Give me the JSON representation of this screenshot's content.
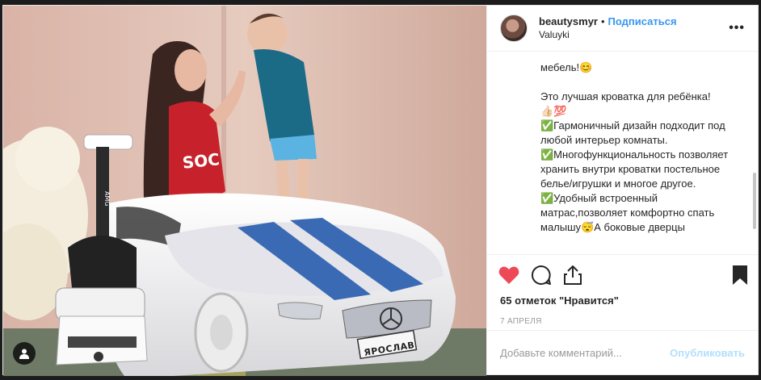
{
  "post": {
    "username": "beautysmyr",
    "separator": "•",
    "follow_label": "Подписаться",
    "location": "Valuyki",
    "more_label": "•••"
  },
  "photo": {
    "plate_text": "ЯРОСЛАВ"
  },
  "caption": {
    "lines": [
      "мебель!😊",
      "",
      "Это лучшая кроватка для ребёнка!",
      "👍🏻💯",
      "✅Гармоничный дизайн подходит под любой интерьер комнаты.",
      "✅Многофункциональность позволяет хранить внутри кроватки постельное белье/игрушки и многое другое.",
      "✅Удобный встроенный матрас,позволяет комфортно спать малышу😴А боковые дверцы"
    ]
  },
  "stats": {
    "likes": "65 отметок \"Нравится\"",
    "date": "7 апреля"
  },
  "comment": {
    "placeholder": "Добавьте комментарий...",
    "publish_label": "Опубликовать"
  },
  "colors": {
    "like_red": "#ed4956",
    "link_blue": "#3897f0",
    "publish_disabled": "#b2dffc"
  },
  "icons": {
    "like": "heart-icon",
    "comment": "comment-icon",
    "share": "share-icon",
    "save": "bookmark-icon",
    "tag": "user-tag-icon"
  }
}
